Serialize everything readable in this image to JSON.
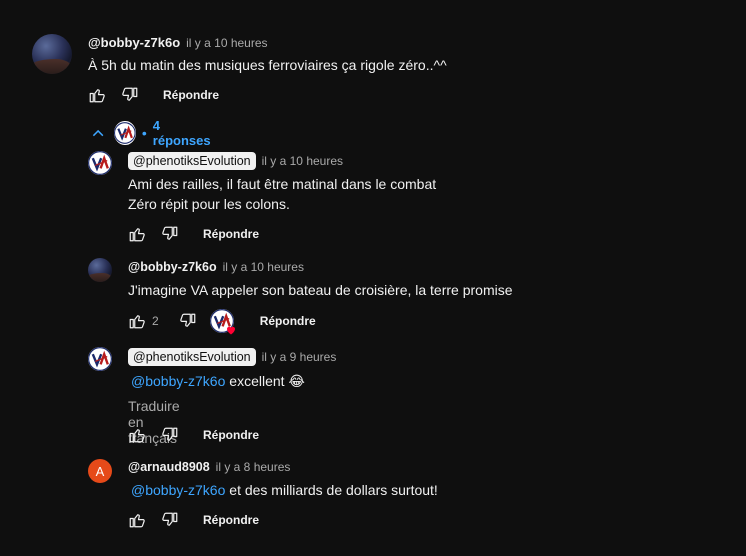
{
  "thread": {
    "author": "@bobby-z7k6o",
    "time": "il y a 10 heures",
    "text": "À 5h du matin des musiques ferroviaires ça rigole zéro..^^",
    "reply_label": "Répondre",
    "replies_count_label": "4 réponses",
    "replies_separator": "•"
  },
  "replies": [
    {
      "author": "@phenotiksEvolution",
      "time": "il y a 10 heures",
      "lines": [
        "Ami des railles, il faut être matinal dans le combat",
        "Zéro répit pour les colons."
      ],
      "reply_label": "Répondre"
    },
    {
      "author": "@bobby-z7k6o",
      "time": "il y a 10 heures",
      "text": "J'imagine VA appeler son bateau de croisière, la terre promise",
      "likes": "2",
      "reply_label": "Répondre"
    },
    {
      "author": "@phenotiksEvolution",
      "time": "il y a 9 heures",
      "mention": "@bobby-z7k6o",
      "text": "excellent",
      "emoji": "😂",
      "translate": "Traduire en français",
      "reply_label": "Répondre"
    },
    {
      "author": "@arnaud8908",
      "avatar_letter": "A",
      "time": "il y a 8 heures",
      "mention": "@bobby-z7k6o",
      "text": "et des milliards de dollars surtout!",
      "reply_label": "Répondre"
    }
  ],
  "icons": {
    "like": "thumbs-up-icon",
    "dislike": "thumbs-down-icon",
    "collapse": "chevron-up-icon",
    "heart": "heart-icon"
  },
  "colors": {
    "background": "#0f0f0f",
    "link": "#3ea6ff",
    "secondary_text": "#aaaaaa",
    "avatar_arnaud": "#e64a19",
    "heart": "#ff0033"
  }
}
